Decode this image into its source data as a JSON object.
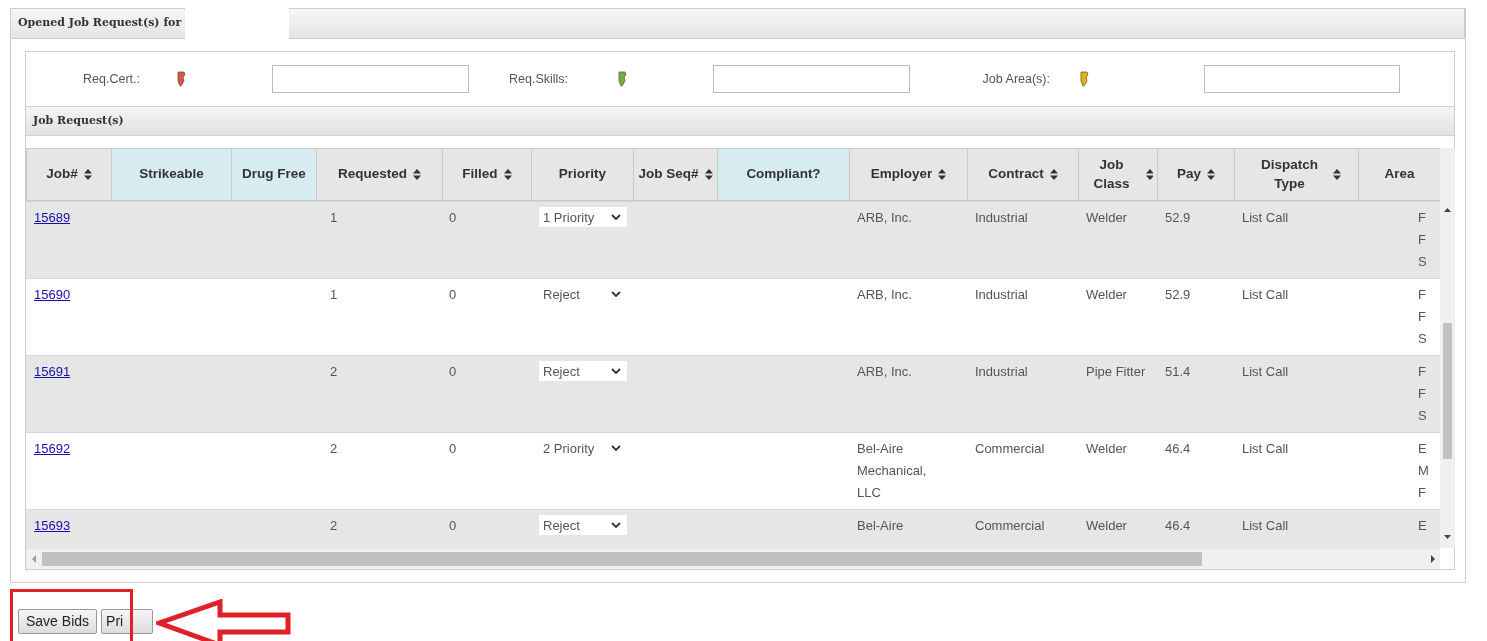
{
  "panel": {
    "title": "Opened Job Request(s) for"
  },
  "filters": [
    {
      "label": "Req.Cert.:",
      "color": "#d9534f"
    },
    {
      "label": "Req.Skills:",
      "color": "#6fae4a"
    },
    {
      "label": "Job Area(s):",
      "color": "#e0b21c"
    }
  ],
  "section": {
    "title": "Job Request(s)"
  },
  "table": {
    "columns": [
      {
        "label": "Job#",
        "sortable": true,
        "highlighted": false
      },
      {
        "label": "Strikeable",
        "sortable": false,
        "highlighted": true
      },
      {
        "label": "Drug Free",
        "sortable": false,
        "highlighted": true
      },
      {
        "label": "Requested",
        "sortable": true,
        "highlighted": false
      },
      {
        "label": "Filled",
        "sortable": true,
        "highlighted": false
      },
      {
        "label": "Priority",
        "sortable": false,
        "highlighted": false
      },
      {
        "label": "Job Seq#",
        "sortable": true,
        "highlighted": false
      },
      {
        "label": "Compliant?",
        "sortable": false,
        "highlighted": true
      },
      {
        "label": "Employer",
        "sortable": true,
        "highlighted": false
      },
      {
        "label": "Contract",
        "sortable": true,
        "highlighted": false
      },
      {
        "label": "Job Class",
        "sortable": true,
        "highlighted": false
      },
      {
        "label": "Pay",
        "sortable": true,
        "highlighted": false
      },
      {
        "label": "Dispatch Type",
        "sortable": true,
        "highlighted": false
      },
      {
        "label": "Area",
        "sortable": false,
        "highlighted": false
      }
    ],
    "rows": [
      {
        "job": "15689",
        "requested": "1",
        "filled": "0",
        "priority": "1 Priority",
        "employer": "ARB, Inc.",
        "contract": "Industrial",
        "job_class": "Welder",
        "pay": "52.9",
        "dispatch_type": "List Call",
        "area": [
          "F",
          "F",
          "S"
        ]
      },
      {
        "job": "15690",
        "requested": "1",
        "filled": "0",
        "priority": "Reject",
        "employer": "ARB, Inc.",
        "contract": "Industrial",
        "job_class": "Welder",
        "pay": "52.9",
        "dispatch_type": "List Call",
        "area": [
          "F",
          "F",
          "S"
        ]
      },
      {
        "job": "15691",
        "requested": "2",
        "filled": "0",
        "priority": "Reject",
        "employer": "ARB, Inc.",
        "contract": "Industrial",
        "job_class": "Pipe Fitter",
        "pay": "51.4",
        "dispatch_type": "List Call",
        "area": [
          "F",
          "F",
          "S"
        ]
      },
      {
        "job": "15692",
        "requested": "2",
        "filled": "0",
        "priority": "2 Priority",
        "employer": "Bel-Aire Mechanical, LLC",
        "contract": "Commercial",
        "job_class": "Welder",
        "pay": "46.4",
        "dispatch_type": "List Call",
        "area": [
          "E",
          "M",
          "F"
        ]
      },
      {
        "job": "15693",
        "requested": "2",
        "filled": "0",
        "priority": "Reject",
        "employer": "Bel-Aire",
        "contract": "Commercial",
        "job_class": "Welder",
        "pay": "46.4",
        "dispatch_type": "List Call",
        "area": [
          "E"
        ]
      }
    ]
  },
  "buttons": [
    {
      "label": "Save Bids"
    },
    {
      "label": "Pri"
    }
  ]
}
